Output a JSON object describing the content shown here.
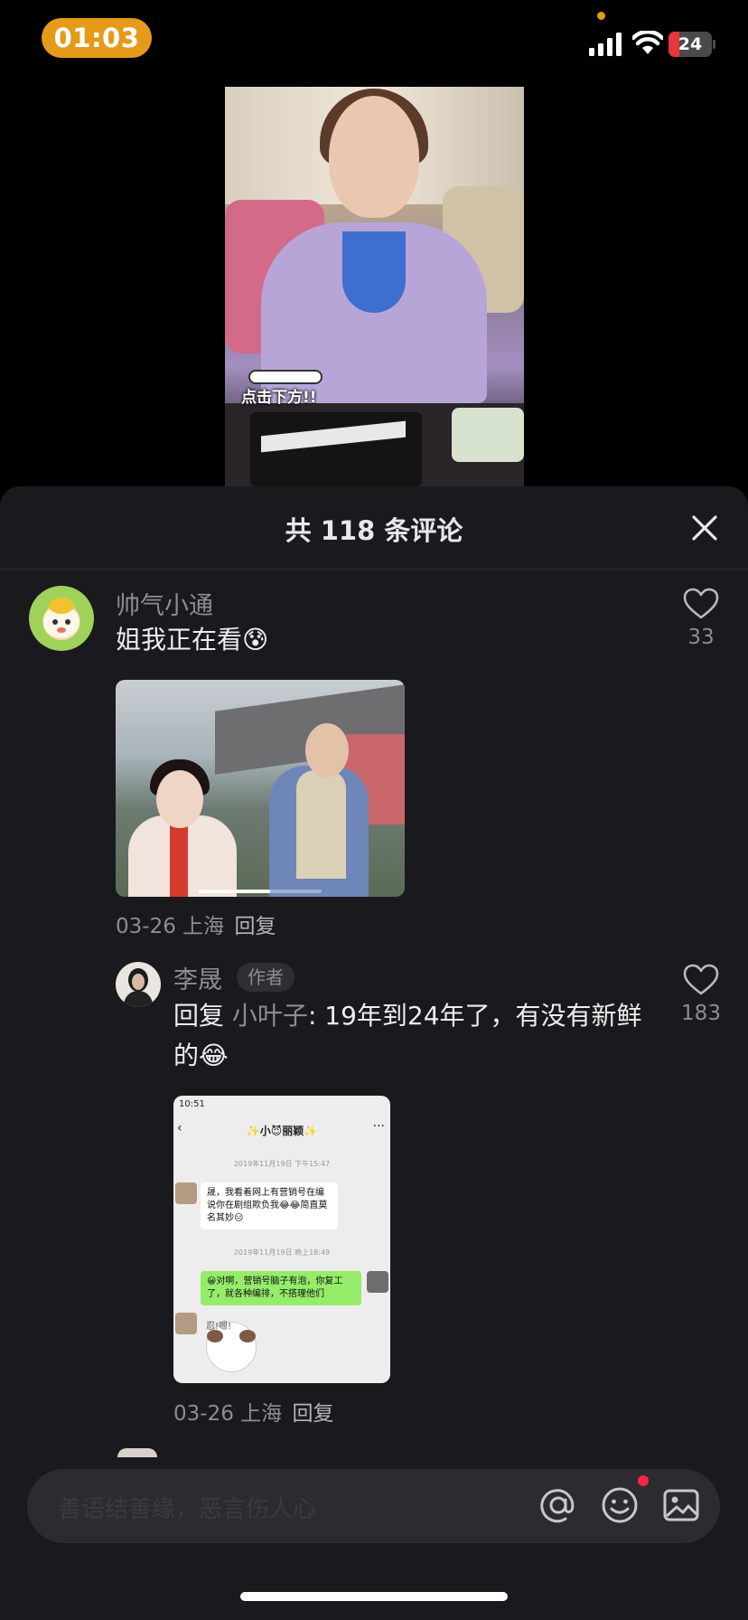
{
  "status_bar": {
    "time": "01:03",
    "battery_level": "24",
    "battery_fraction": 0.24,
    "colors": {
      "time_pill": "#e59a19",
      "battery_low": "#e8363b"
    }
  },
  "video": {
    "overlay_text": "点击下方!!"
  },
  "comments_sheet": {
    "title": "共 118 条评论",
    "comments": [
      {
        "username": "帅气小通",
        "text": "姐我正在看",
        "emoji": "😰",
        "likes": "33",
        "date": "03-26",
        "location": "上海",
        "reply_label": "回复",
        "video_progress": 0.58
      },
      {
        "username": "李晟",
        "badge": "作者",
        "reply_prefix": "回复",
        "reply_to": "小叶子",
        "text": ": 19年到24年了，有没有新鲜的",
        "emoji": "😂",
        "likes": "183",
        "date": "03-26",
        "location": "上海",
        "reply_label": "回复",
        "screenshot": {
          "status_time": "10:51",
          "chat_title": "✨小😈丽颖✨",
          "date_1": "2019年11月19日 下午15:47",
          "message_1": "晟，我看着网上有营销号在编说你在剧组欺负我😂😂简直莫名其妙😑",
          "date_2": "2019年11月19日 晚上18:49",
          "message_2": "😀对啊，营销号脑子有泡，你复工了，就各种编排，不搭理他们",
          "sticker_text": "忍!嗯!"
        }
      }
    ]
  },
  "input_bar": {
    "placeholder": "善语结善缘，恶言伤人心",
    "icons": [
      "at-icon",
      "emoji-icon",
      "image-icon"
    ],
    "notification_dot_color": "#ff2442"
  }
}
